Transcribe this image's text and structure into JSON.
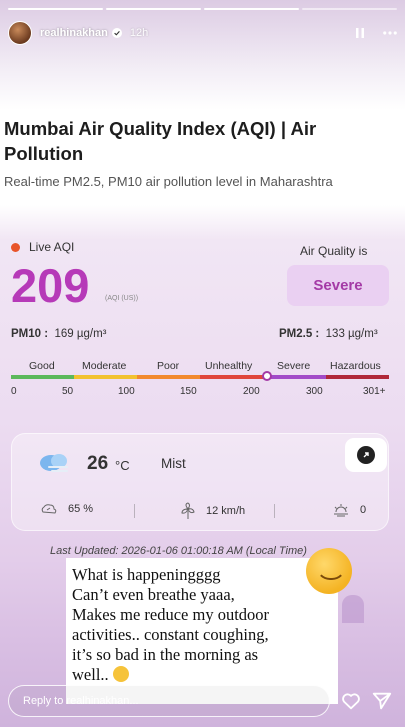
{
  "story": {
    "username": "realhinakhan",
    "time": "12h",
    "segments": 4,
    "current_segment": 3,
    "reply_placeholder": "Reply to realhinakhan..."
  },
  "article": {
    "title": "Mumbai Air Quality Index (AQI) | Air Pollution",
    "subtitle": "Real-time PM2.5, PM10 air pollution level in Maharashtra"
  },
  "aqi": {
    "live_label": "Live AQI",
    "value": "209",
    "unit": "(AQI (US))",
    "quality_label": "Air Quality is",
    "quality": "Severe",
    "pm10_label": "PM10 :",
    "pm10_value": "169 µg/m³",
    "pm25_label": "PM2.5 :",
    "pm25_value": "133 µg/m³",
    "scale": {
      "categories": [
        "Good",
        "Moderate",
        "Poor",
        "Unhealthy",
        "Severe",
        "Hazardous"
      ],
      "colors": [
        "#5cb85c",
        "#f2c230",
        "#f28a2e",
        "#e0463c",
        "#a24bc8",
        "#b0283a"
      ],
      "breakpoints": [
        "0",
        "50",
        "100",
        "150",
        "200",
        "300",
        "301+"
      ],
      "marker_value": 209
    }
  },
  "weather": {
    "temp": "26",
    "temp_unit": "°C",
    "condition": "Mist",
    "humidity": "65 %",
    "wind": "12 km/h",
    "uv": "0"
  },
  "updated": "Last Updated: 2026-01-06 01:00:18 AM (Local Time)",
  "sticker": {
    "lines": [
      "What is happeningggg",
      "Can’t even breathe yaaa,",
      "Makes me reduce my outdoor",
      "activities.. constant coughing,",
      "it’s so bad in the morning as",
      "well.."
    ]
  }
}
